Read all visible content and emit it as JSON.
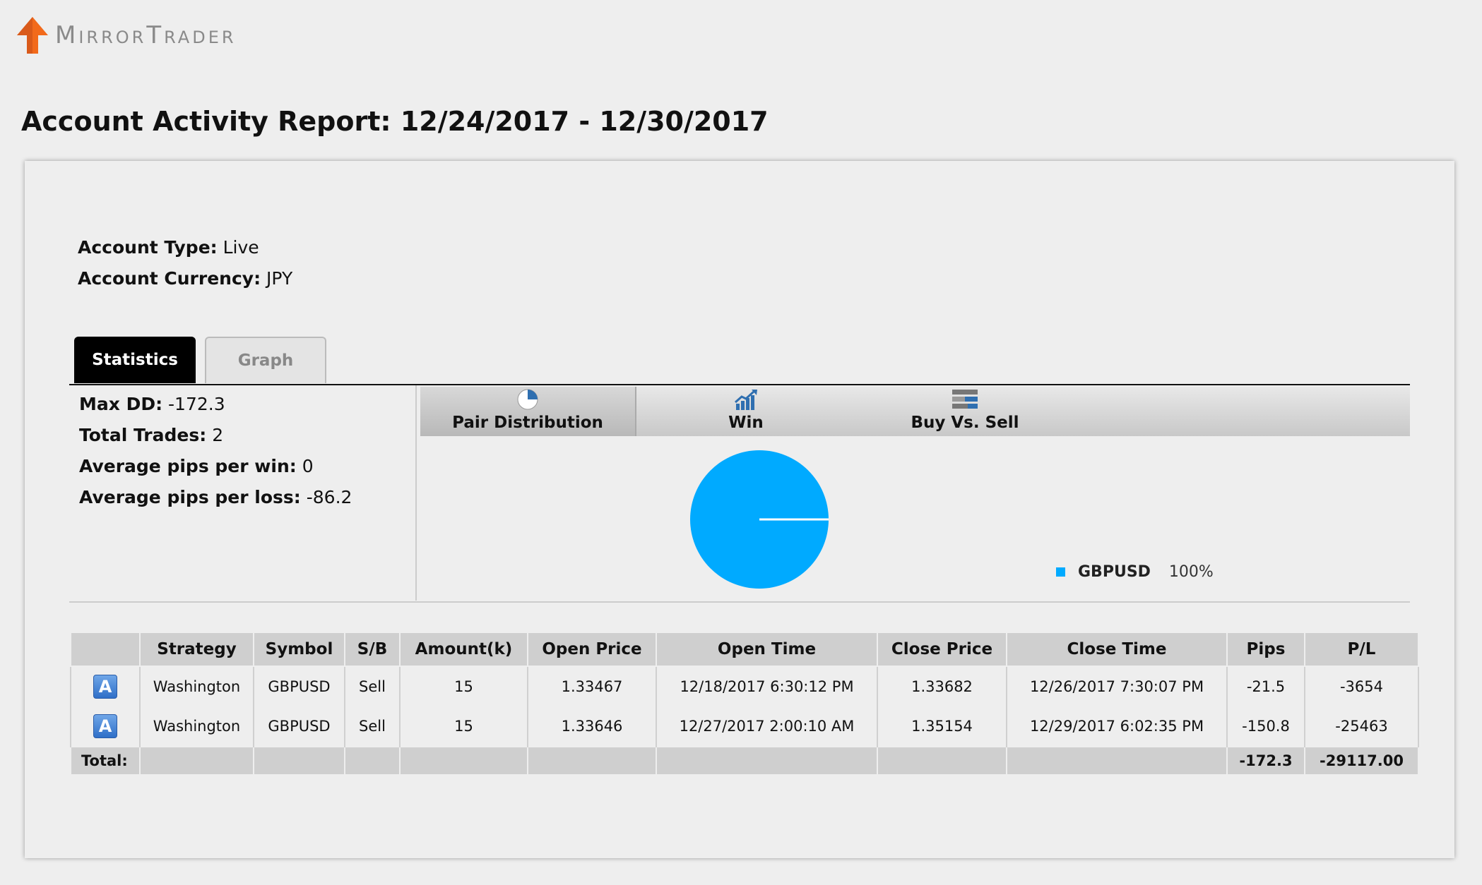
{
  "brand": {
    "name": "MirrorTrader",
    "arrow_color": "#f26a1b"
  },
  "page": {
    "title": "Account Activity Report: 12/24/2017 - 12/30/2017"
  },
  "account": {
    "type_label": "Account Type:",
    "type_value": " Live",
    "currency_label": "Account Currency:",
    "currency_value": " JPY"
  },
  "tabs": [
    {
      "label": "Statistics",
      "active": true
    },
    {
      "label": "Graph",
      "active": false
    }
  ],
  "stats": [
    {
      "label": "Max DD:",
      "value": " -172.3"
    },
    {
      "label": "Total Trades:",
      "value": " 2"
    },
    {
      "label": "Average pips per win:",
      "value": " 0"
    },
    {
      "label": "Average pips per loss:",
      "value": " -86.2"
    }
  ],
  "chart_tabs": [
    {
      "label": "Pair Distribution",
      "icon": "pie-chart-icon",
      "active": true
    },
    {
      "label": "Win",
      "icon": "trend-up-icon",
      "active": false
    },
    {
      "label": "Buy Vs. Sell",
      "icon": "stacked-bars-icon",
      "active": false
    }
  ],
  "chart_data": {
    "type": "pie",
    "slices": [
      {
        "label": "GBPUSD",
        "value": 100,
        "display": "100%",
        "color": "#00aaff"
      }
    ]
  },
  "table": {
    "headers": [
      "",
      "Strategy",
      "Symbol",
      "S/B",
      "Amount(k)",
      "Open Price",
      "Open Time",
      "Close Price",
      "Close Time",
      "Pips",
      "P/L"
    ],
    "rows": [
      {
        "icon": "A",
        "strategy": "Washington",
        "symbol": "GBPUSD",
        "sb": "Sell",
        "amount": "15",
        "open_price": "1.33467",
        "open_time": "12/18/2017 6:30:12 PM",
        "close_price": "1.33682",
        "close_time": "12/26/2017 7:30:07 PM",
        "pips": "-21.5",
        "pl": "-3654"
      },
      {
        "icon": "A",
        "strategy": "Washington",
        "symbol": "GBPUSD",
        "sb": "Sell",
        "amount": "15",
        "open_price": "1.33646",
        "open_time": "12/27/2017 2:00:10 AM",
        "close_price": "1.35154",
        "close_time": "12/29/2017 6:02:35 PM",
        "pips": "-150.8",
        "pl": "-25463"
      }
    ],
    "total": {
      "label": "Total:",
      "pips": "-172.3",
      "pl": "-29117.00"
    }
  },
  "colors": {
    "negative": "#e00000",
    "pie": "#00aaff"
  }
}
